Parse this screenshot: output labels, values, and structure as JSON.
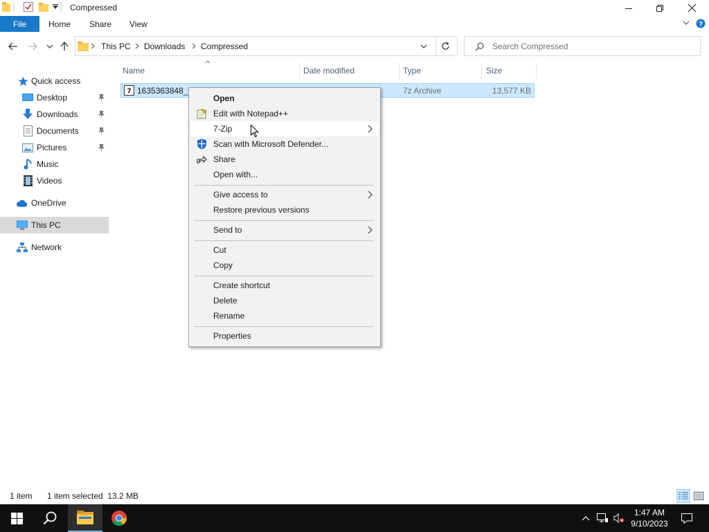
{
  "window": {
    "title": "Compressed"
  },
  "ribbon": {
    "tabs": [
      "File",
      "Home",
      "Share",
      "View"
    ]
  },
  "address": {
    "breadcrumbs": [
      "This PC",
      "Downloads",
      "Compressed"
    ],
    "search_placeholder": "Search Compressed"
  },
  "nav": {
    "items": [
      {
        "label": "Quick access",
        "icon": "star-icon"
      },
      {
        "label": "Desktop",
        "icon": "desktop-icon",
        "pinned": true
      },
      {
        "label": "Downloads",
        "icon": "download-arrow-icon",
        "pinned": true
      },
      {
        "label": "Documents",
        "icon": "document-icon",
        "pinned": true
      },
      {
        "label": "Pictures",
        "icon": "pictures-icon",
        "pinned": true
      },
      {
        "label": "Music",
        "icon": "music-note-icon"
      },
      {
        "label": "Videos",
        "icon": "video-film-icon"
      },
      {
        "label": "OneDrive",
        "icon": "cloud-icon"
      },
      {
        "label": "This PC",
        "icon": "computer-icon",
        "selected": true
      },
      {
        "label": "Network",
        "icon": "network-icon"
      }
    ]
  },
  "columns": [
    "Name",
    "Date modified",
    "Type",
    "Size"
  ],
  "files": [
    {
      "name": "1635363848_ta",
      "date": "",
      "type": "7z Archive",
      "size": "13,577 KB",
      "selected": true
    }
  ],
  "context_menu": {
    "items": [
      {
        "label": "Open",
        "bold": true
      },
      {
        "label": "Edit with Notepad++",
        "icon": "notepadpp-icon"
      },
      {
        "label": "7-Zip",
        "submenu": true,
        "hover": true
      },
      {
        "label": "Scan with Microsoft Defender...",
        "icon": "defender-shield-icon"
      },
      {
        "label": "Share",
        "icon": "share-icon"
      },
      {
        "label": "Open with..."
      },
      {
        "label": "Give access to",
        "submenu": true
      },
      {
        "label": "Restore previous versions"
      },
      {
        "label": "Send to",
        "submenu": true
      },
      {
        "label": "Cut"
      },
      {
        "label": "Copy"
      },
      {
        "label": "Create shortcut"
      },
      {
        "label": "Delete"
      },
      {
        "label": "Rename"
      },
      {
        "label": "Properties"
      }
    ]
  },
  "status": {
    "item_count": "1 item",
    "selection": "1 item selected  13.2 MB"
  },
  "taskbar": {
    "time": "1:47 AM",
    "date": "9/10/2023"
  },
  "colors": {
    "accent": "#1979ca",
    "selection_bg": "#cce8ff",
    "taskbar_bg": "#101010"
  }
}
